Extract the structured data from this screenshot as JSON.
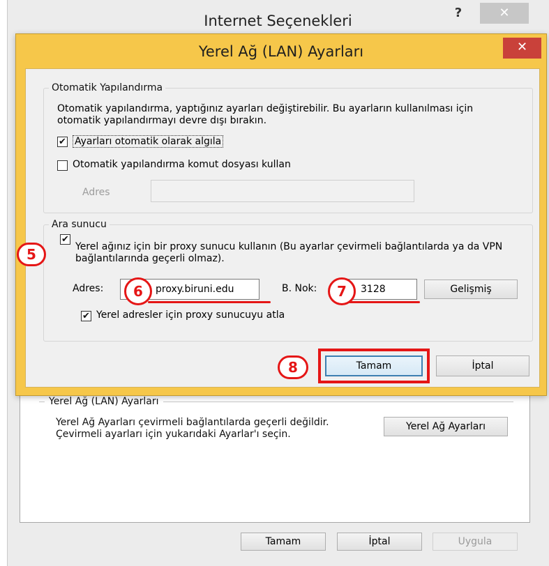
{
  "outer_window": {
    "title": "Internet Seçenekleri",
    "help_glyph": "?",
    "close_glyph": "✕",
    "lan_section": {
      "legend": "Yerel Ağ (LAN) Ayarları",
      "description": "Yerel Ağ Ayarları çevirmeli bağlantılarda geçerli değildir. Çevirmeli ayarları için yukarıdaki Ayarlar'ı seçin.",
      "button": "Yerel Ağ Ayarları"
    },
    "buttons": {
      "ok": "Tamam",
      "cancel": "İptal",
      "apply": "Uygula"
    }
  },
  "dialog": {
    "title": "Yerel Ağ (LAN) Ayarları",
    "close_glyph": "✕",
    "auto_config": {
      "legend": "Otomatik Yapılandırma",
      "description": "Otomatik yapılandırma, yaptığınız ayarları değiştirebilir. Bu ayarların kullanılması için otomatik yapılandırmayı devre dışı bırakın.",
      "detect_label": "Ayarları otomatik olarak algıla",
      "detect_checked": true,
      "script_label": "Otomatik yapılandırma komut dosyası kullan",
      "script_checked": false,
      "address_label": "Adres",
      "address_value": ""
    },
    "proxy": {
      "legend": "Ara sunucu",
      "use_proxy_label": "Yerel ağınız için bir proxy sunucu kullanın (Bu ayarlar çevirmeli bağlantılarda ya da VPN bağlantılarında geçerli olmaz).",
      "use_proxy_checked": true,
      "address_label": "Adres:",
      "address_value": "proxy.biruni.edu",
      "port_label": "B. Nok:",
      "port_value": "3128",
      "advanced_button": "Gelişmiş",
      "bypass_label": "Yerel adresler için proxy sunucuyu atla",
      "bypass_checked": true
    },
    "buttons": {
      "ok": "Tamam",
      "cancel": "İptal"
    }
  },
  "annotations": {
    "step5": "5",
    "step6": "6",
    "step7": "7",
    "step8": "8",
    "accent_color": "#e51616"
  },
  "check_glyph": "✔"
}
